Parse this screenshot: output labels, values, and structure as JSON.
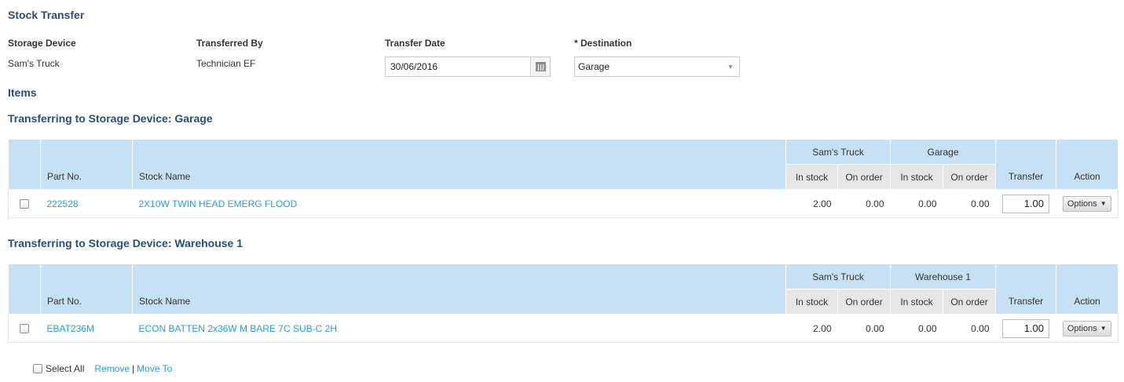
{
  "page": {
    "title": "Stock Transfer"
  },
  "fields": {
    "storage_device": {
      "label": "Storage Device",
      "value": "Sam's Truck"
    },
    "transferred_by": {
      "label": "Transferred By",
      "value": "Technician EF"
    },
    "transfer_date": {
      "label": "Transfer Date",
      "value": "30/06/2016"
    },
    "destination": {
      "label": "* Destination",
      "value": "Garage"
    }
  },
  "items_heading": "Items",
  "sections": [
    {
      "heading": "Transferring to Storage Device: Garage",
      "headers": {
        "part_no": "Part No.",
        "stock_name": "Stock Name",
        "source_group": "Sam's Truck",
        "dest_group": "Garage",
        "in_stock": "In stock",
        "on_order": "On order",
        "transfer": "Transfer",
        "action": "Action"
      },
      "rows": [
        {
          "part_no": "222528",
          "stock_name": "2X10W TWIN HEAD EMERG FLOOD",
          "src_in_stock": "2.00",
          "src_on_order": "0.00",
          "dst_in_stock": "0.00",
          "dst_on_order": "0.00",
          "transfer": "1.00",
          "action": "Options"
        }
      ]
    },
    {
      "heading": "Transferring to Storage Device: Warehouse 1",
      "headers": {
        "part_no": "Part No.",
        "stock_name": "Stock Name",
        "source_group": "Sam's Truck",
        "dest_group": "Warehouse 1",
        "in_stock": "In stock",
        "on_order": "On order",
        "transfer": "Transfer",
        "action": "Action"
      },
      "rows": [
        {
          "part_no": "EBAT236M",
          "stock_name": "ECON BATTEN 2x36W M BARE 7C SUB-C 2H",
          "src_in_stock": "2.00",
          "src_on_order": "0.00",
          "dst_in_stock": "0.00",
          "dst_on_order": "0.00",
          "transfer": "1.00",
          "action": "Options"
        }
      ]
    }
  ],
  "footer": {
    "select_all": "Select All",
    "remove": "Remove",
    "separator": "|",
    "move_to": "Move To"
  },
  "icons": {
    "date_picker": "calendar-icon",
    "dropdown": "chevron-down-icon",
    "options_caret": "caret-down-icon"
  },
  "colors": {
    "heading": "#2a4e7a",
    "link": "#2b9bd6",
    "table_header": "#c6e1f5",
    "subheader": "#e6e6e6"
  }
}
